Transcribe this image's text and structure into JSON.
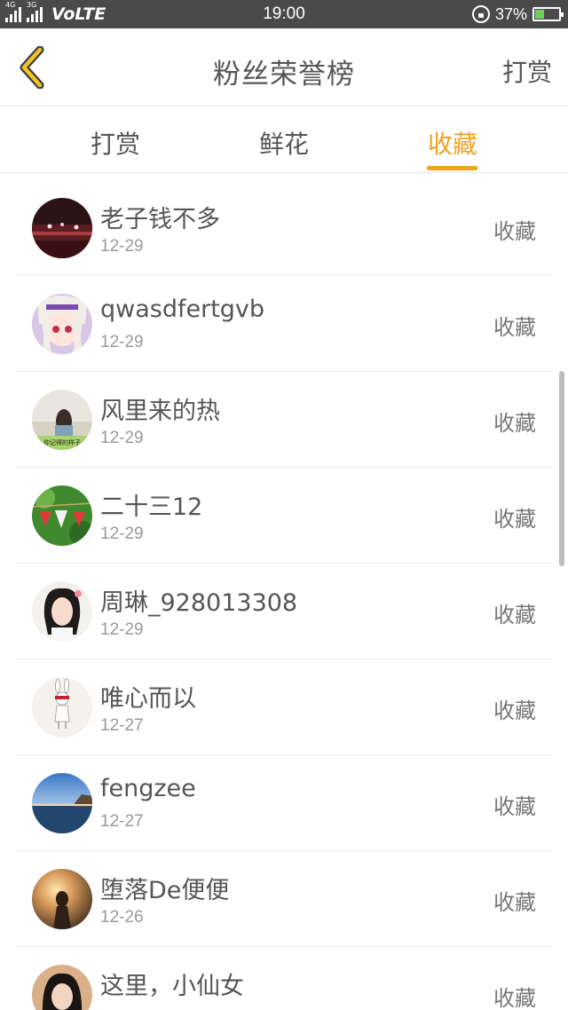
{
  "status_bar": {
    "network_tags": [
      "4G",
      "3G"
    ],
    "network_label": "VoLTE",
    "time": "19:00",
    "battery_percent_text": "37%",
    "battery_level": 0.37,
    "battery_color": "#6ed05a"
  },
  "header": {
    "back_icon": "chevron-left-icon",
    "title": "粉丝荣誉榜",
    "action_label": "打赏",
    "accent_color": "#f2c425"
  },
  "tabs": {
    "items": [
      {
        "label": "打赏"
      },
      {
        "label": "鲜花"
      },
      {
        "label": "收藏"
      }
    ],
    "active_index": 2,
    "active_color": "#f2a223"
  },
  "list": {
    "items": [
      {
        "name": "老子钱不多",
        "date": "12-29",
        "kind": "收藏"
      },
      {
        "name": "qwasdfertgvb",
        "date": "12-29",
        "kind": "收藏"
      },
      {
        "name": "风里来的热",
        "date": "12-29",
        "kind": "收藏",
        "avatar_caption": "你记得的样子"
      },
      {
        "name": "二十三12",
        "date": "12-29",
        "kind": "收藏"
      },
      {
        "name": "周琳_928013308",
        "date": "12-29",
        "kind": "收藏"
      },
      {
        "name": "唯心而以",
        "date": "12-27",
        "kind": "收藏"
      },
      {
        "name": "fengzee",
        "date": "12-27",
        "kind": "收藏"
      },
      {
        "name": "堕落De便便",
        "date": "12-26",
        "kind": "收藏"
      },
      {
        "name": "这里，小仙女",
        "date": "",
        "kind": "收藏"
      }
    ]
  }
}
